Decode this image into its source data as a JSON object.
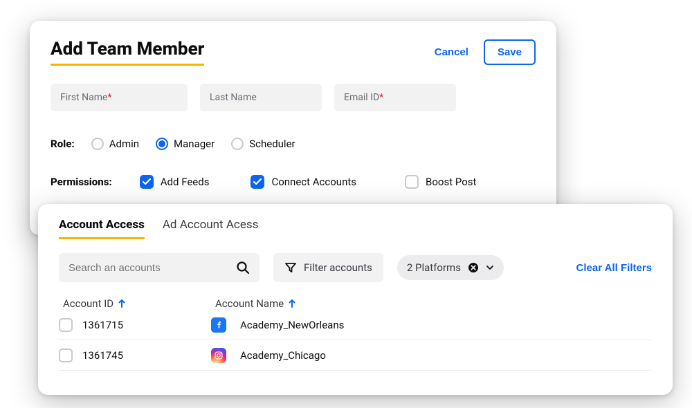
{
  "header": {
    "title": "Add Team Member",
    "cancel": "Cancel",
    "save": "Save"
  },
  "fields": {
    "first_name_label": "First Name",
    "last_name_label": "Last Name",
    "email_label": "Email ID"
  },
  "role": {
    "label": "Role:",
    "options": [
      "Admin",
      "Manager",
      "Scheduler"
    ],
    "selected": "Manager"
  },
  "permissions": {
    "label": "Permissions:",
    "items": [
      {
        "label": "Add Feeds",
        "checked": true
      },
      {
        "label": "Connect Accounts",
        "checked": true
      },
      {
        "label": "Boost Post",
        "checked": false
      }
    ]
  },
  "tabs": {
    "items": [
      "Account Access",
      "Ad Account Acess"
    ],
    "active": 0
  },
  "filters": {
    "search_placeholder": "Search an accounts",
    "filter_label": "Filter accounts",
    "platform_chip": "2 Platforms",
    "clear": "Clear All Filters"
  },
  "table": {
    "cols": [
      "Account ID",
      "Account Name"
    ],
    "rows": [
      {
        "id": "1361715",
        "platform": "facebook",
        "name": "Academy_NewOrleans"
      },
      {
        "id": "1361745",
        "platform": "instagram",
        "name": "Academy_Chicago"
      }
    ]
  }
}
